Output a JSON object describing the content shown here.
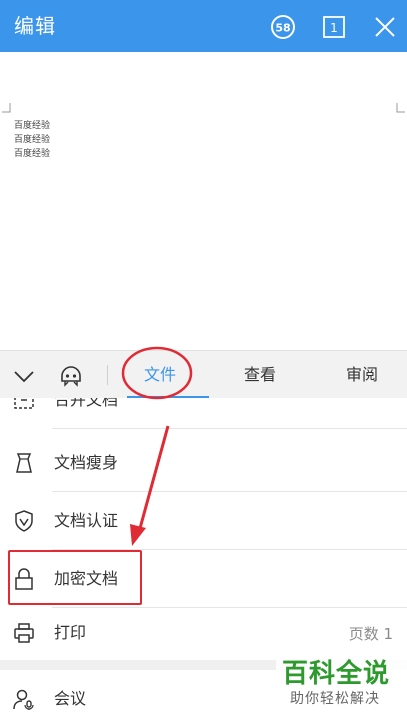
{
  "header": {
    "title": "编辑",
    "badge_58": "58",
    "page_count": "1"
  },
  "document": {
    "lines": [
      "百度经验",
      "百度经验",
      "百度经验"
    ]
  },
  "tabs": [
    {
      "label": "文件",
      "active": true
    },
    {
      "label": "查看",
      "active": false
    },
    {
      "label": "审阅",
      "active": false
    }
  ],
  "menu": {
    "items": [
      {
        "label": "合并文档",
        "icon": "merge-icon"
      },
      {
        "label": "文档瘦身",
        "icon": "slim-icon"
      },
      {
        "label": "文档认证",
        "icon": "shield-check-icon"
      },
      {
        "label": "加密文档",
        "icon": "lock-icon"
      },
      {
        "label": "打印",
        "icon": "printer-icon",
        "right_text": "页数 1"
      },
      {
        "label": "会议",
        "icon": "meeting-icon"
      }
    ]
  },
  "watermark": {
    "main": "百科全说",
    "sub": "助你轻松解决"
  },
  "colors": {
    "topbar": "#3b95ea",
    "annotation_red": "#e02b35",
    "watermark_green": "#2c9a2c"
  }
}
